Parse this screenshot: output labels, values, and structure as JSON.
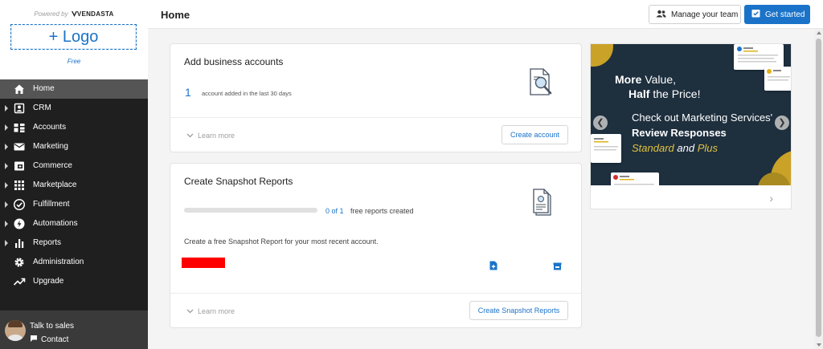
{
  "brand": {
    "powered_by": "Powered by",
    "vendor": "VENDASTA",
    "logo_placeholder": "+ Logo",
    "plan": "Free"
  },
  "sidebar": {
    "items": [
      {
        "label": "Home",
        "icon": "home-icon",
        "active": true,
        "expandable": false
      },
      {
        "label": "CRM",
        "icon": "crm-icon",
        "active": false,
        "expandable": true
      },
      {
        "label": "Accounts",
        "icon": "accounts-icon",
        "active": false,
        "expandable": true
      },
      {
        "label": "Marketing",
        "icon": "mail-icon",
        "active": false,
        "expandable": true
      },
      {
        "label": "Commerce",
        "icon": "commerce-icon",
        "active": false,
        "expandable": true
      },
      {
        "label": "Marketplace",
        "icon": "grid-icon",
        "active": false,
        "expandable": true
      },
      {
        "label": "Fulfillment",
        "icon": "check-circle-icon",
        "active": false,
        "expandable": true
      },
      {
        "label": "Automations",
        "icon": "bolt-icon",
        "active": false,
        "expandable": true
      },
      {
        "label": "Reports",
        "icon": "bar-chart-icon",
        "active": false,
        "expandable": true
      },
      {
        "label": "Administration",
        "icon": "gear-icon",
        "active": false,
        "expandable": false
      },
      {
        "label": "Upgrade",
        "icon": "trending-up-icon",
        "active": false,
        "expandable": false
      }
    ],
    "talk_to_sales": "Talk to sales",
    "contact": "Contact"
  },
  "header": {
    "title": "Home",
    "manage_team": "Manage your team",
    "get_started": "Get started"
  },
  "business_card": {
    "title": "Add business accounts",
    "count": "1",
    "count_text": "account added in the last 30 days",
    "learn_more": "Learn more",
    "create_button": "Create account"
  },
  "snapshot_card": {
    "title": "Create Snapshot Reports",
    "progress_fraction": 0,
    "progress_text": "0 of 1",
    "progress_suffix": "free reports created",
    "description": "Create a free Snapshot Report for your most recent account.",
    "learn_more": "Learn more",
    "create_button": "Create Snapshot Reports"
  },
  "promo": {
    "line1_bold": "More",
    "line1_rest": " Value,",
    "line2_bold": "Half",
    "line2_rest": " the Price!",
    "line3": "Check out Marketing Services'",
    "line4": "Review Responses",
    "line5_a": "Standard",
    "line5_and": " and ",
    "line5_b": "Plus"
  },
  "colors": {
    "accent": "#1a73c8",
    "sidebar_bg": "#1f1f1f",
    "banner_bg": "#1e2f3e",
    "banner_gold": "#c9a227"
  }
}
